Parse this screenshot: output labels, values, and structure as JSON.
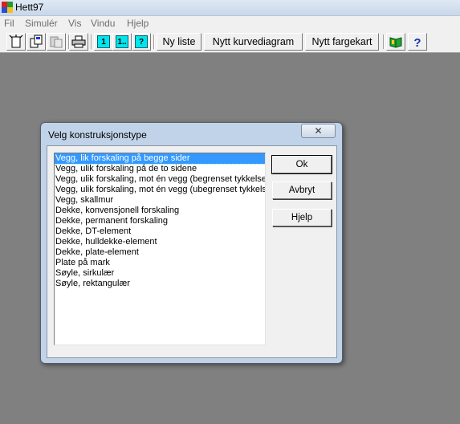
{
  "window": {
    "title": "Hett97"
  },
  "menu": [
    "Fil",
    "Simulér",
    "Vis",
    "Vindu",
    "Hjelp"
  ],
  "toolbar": {
    "icon_buttons": [
      "new-document-icon",
      "copy-icon",
      "paste-icon",
      "print-icon"
    ],
    "view_buttons": [
      "1",
      "1..",
      "?"
    ],
    "text_buttons": [
      "Ny liste",
      "Nytt kurvediagram",
      "Nytt fargekart"
    ],
    "extra_buttons": [
      "book-icon",
      "help-icon"
    ]
  },
  "dialog": {
    "title": "Velg konstruksjonstype",
    "close": "✕",
    "items": [
      "Vegg, lik forskaling på begge sider",
      "Vegg, ulik forskaling på de to sidene",
      "Vegg, ulik forskaling, mot én vegg (begrenset tykkelse)",
      "Vegg, ulik forskaling, mot én vegg (ubegrenset tykkelse)",
      "Vegg, skallmur",
      "Dekke, konvensjonell forskaling",
      "Dekke, permanent forskaling",
      "Dekke, DT-element",
      "Dekke, hulldekke-element",
      "Dekke, plate-element",
      "Plate på mark",
      "Søyle, sirkulær",
      "Søyle, rektangulær"
    ],
    "selected_index": 0,
    "buttons": {
      "ok": "Ok",
      "cancel": "Avbryt",
      "help": "Hjelp"
    }
  }
}
